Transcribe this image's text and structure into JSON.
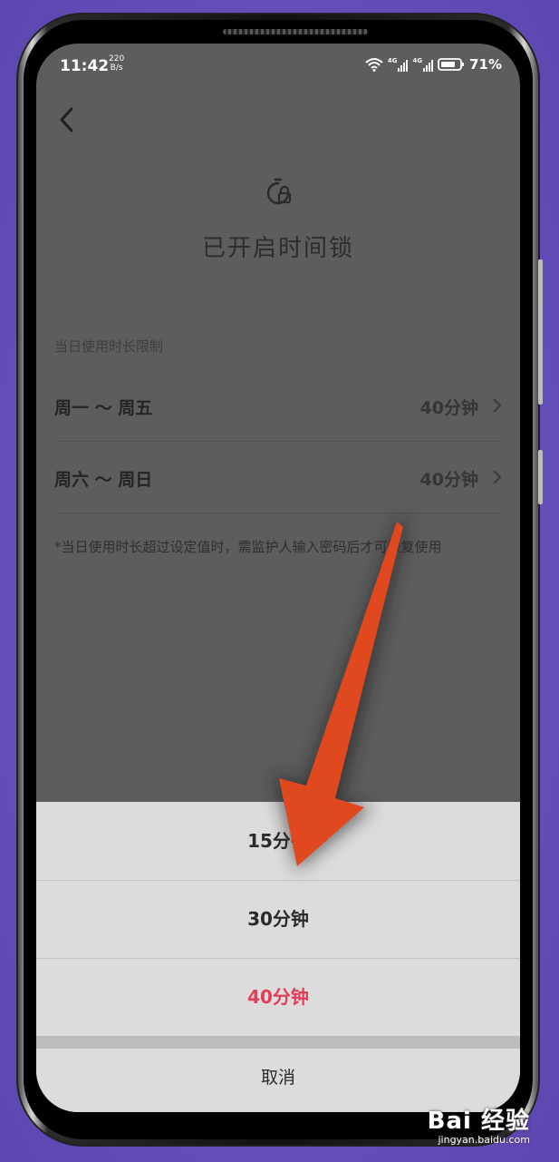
{
  "status_bar": {
    "time": "11:42",
    "net_speed_value": "220",
    "net_speed_unit": "B/s",
    "signal1": "4G",
    "signal2": "4G",
    "battery": "71%"
  },
  "header": {
    "back_icon": "chevron-left-icon",
    "title": "已开启时间锁"
  },
  "settings": {
    "section_label": "当日使用时长限制",
    "rows": [
      {
        "label": "周一 ～ 周五",
        "value": "40分钟"
      },
      {
        "label": "周六 ～ 周日",
        "value": "40分钟"
      }
    ],
    "note": "*当日使用时长超过设定值时，需监护人输入密码后才可恢复使用"
  },
  "sheet": {
    "options": [
      "15分钟",
      "30分钟",
      "40分钟"
    ],
    "selected_index": 2,
    "cancel": "取消"
  },
  "colors": {
    "selected": "#e23e5a",
    "arrow": "#e0491f"
  },
  "watermark": {
    "brand": "Bai 经验",
    "url": "jingyan.baidu.com"
  }
}
